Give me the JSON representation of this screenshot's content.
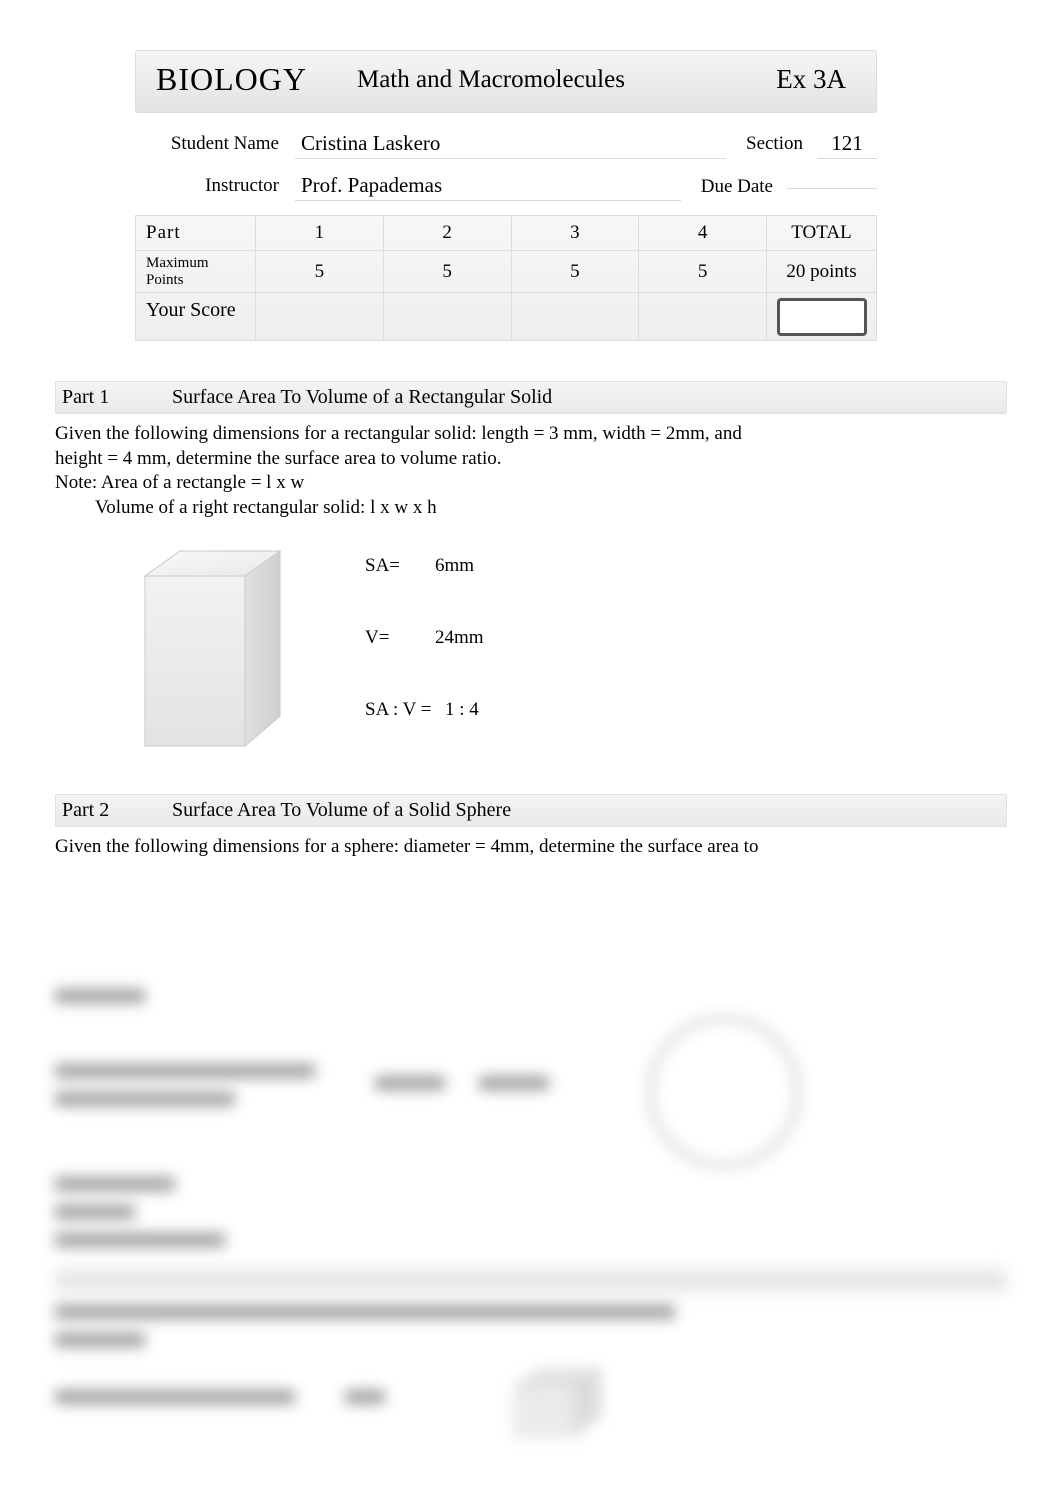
{
  "header": {
    "course": "BIOLOGY",
    "topic": "Math and Macromolecules",
    "exercise": "Ex 3A"
  },
  "info": {
    "student_name_label": "Student Name",
    "student_name": "Cristina Laskero",
    "section_label": "Section",
    "section": "121",
    "instructor_label": "Instructor",
    "instructor": "Prof. Papademas",
    "due_date_label": "Due Date",
    "due_date": ""
  },
  "score_table": {
    "part_label": "Part",
    "parts": [
      "1",
      "2",
      "3",
      "4"
    ],
    "total_label": "TOTAL",
    "max_label": "Maximum Points",
    "max_points": [
      "5",
      "5",
      "5",
      "5"
    ],
    "max_total": "20 points",
    "your_score_label": "Your Score",
    "scores": [
      "",
      "",
      "",
      ""
    ]
  },
  "part1": {
    "label": "Part 1",
    "title": "Surface Area To Volume of a Rectangular Solid",
    "prompt_line1": "Given the following dimensions for a rectangular solid: length = 3 mm, width = 2mm, and",
    "prompt_line2": "height = 4 mm, determine the surface area to volume ratio.",
    "note_line1": "Note: Area of a rectangle = l x w",
    "note_line2": "Volume of a right rectangular solid: l x w x h",
    "sa_label": "SA=",
    "sa_value": "6mm",
    "v_label": "V=",
    "v_value": "24mm",
    "ratio_label": "SA : V =",
    "ratio_value": "1 : 4"
  },
  "part2": {
    "label": "Part 2",
    "title": "Surface Area To Volume of a Solid Sphere",
    "prompt_line1": "Given the following dimensions for a sphere: diameter = 4mm, determine the surface area to"
  }
}
